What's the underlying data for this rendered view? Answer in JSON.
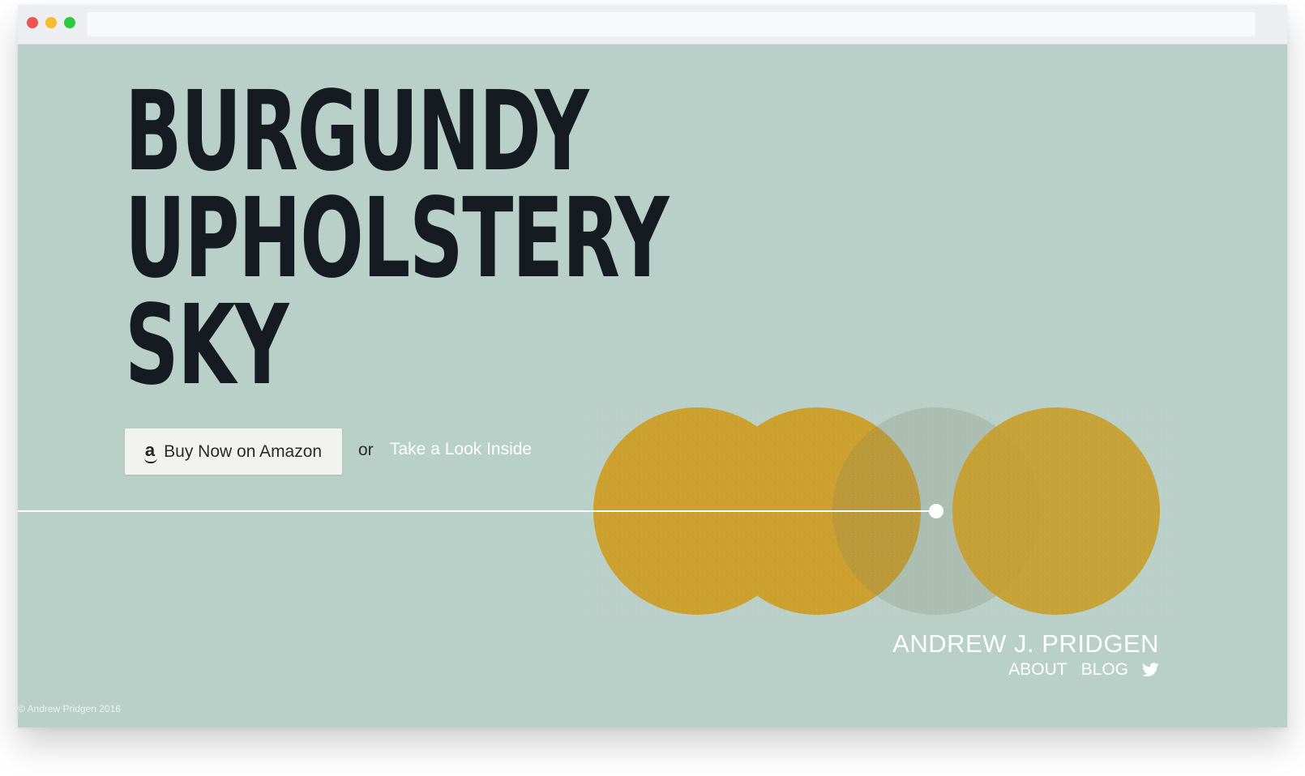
{
  "book": {
    "title_lines": [
      "BURGUNDY",
      "UPHOLSTERY",
      "SKY"
    ]
  },
  "cta": {
    "buy_label": "Buy Now on Amazon",
    "or_text": "or",
    "look_label": "Take a Look Inside"
  },
  "author": {
    "name": "ANDREW J. PRIDGEN",
    "nav": [
      "ABOUT",
      "BLOG"
    ]
  },
  "footer": {
    "copyright": "© Andrew Pridgen 2016"
  },
  "icons": {
    "buy": "amazon-icon",
    "social": "twitter-icon"
  },
  "colors": {
    "background": "#b9d0c8",
    "title": "#161b22",
    "circle_gold": "#cca02e",
    "circle_gray": "#a3b8b0",
    "link": "#ffffff"
  }
}
